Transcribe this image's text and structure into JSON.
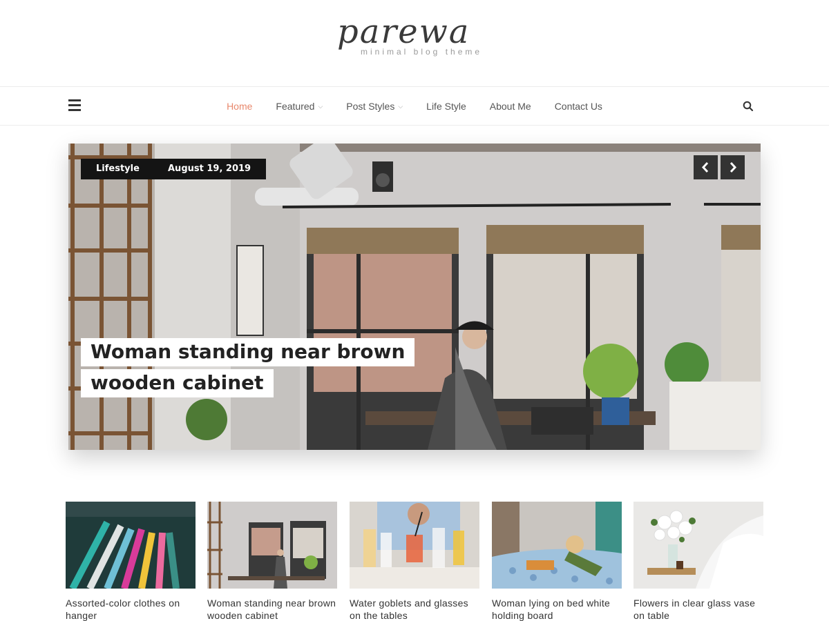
{
  "header": {
    "logo_text": "parewa",
    "tagline": "minimal blog theme"
  },
  "nav": {
    "menu_icon": "hamburger-icon",
    "items": [
      {
        "label": "Home",
        "active": true,
        "has_dropdown": false
      },
      {
        "label": "Featured",
        "active": false,
        "has_dropdown": true
      },
      {
        "label": "Post Styles",
        "active": false,
        "has_dropdown": true
      },
      {
        "label": "Life Style",
        "active": false,
        "has_dropdown": false
      },
      {
        "label": "About Me",
        "active": false,
        "has_dropdown": false
      },
      {
        "label": "Contact Us",
        "active": false,
        "has_dropdown": false
      }
    ],
    "search_icon": "search-icon",
    "active_color": "#e8886c"
  },
  "hero": {
    "category": "Lifestyle",
    "date": "August 19, 2019",
    "title": "Woman standing near brown wooden cabinet",
    "prev_icon": "chevron-left-icon",
    "next_icon": "chevron-right-icon"
  },
  "posts": [
    {
      "title": "Assorted-color clothes on hanger"
    },
    {
      "title": "Woman standing near brown wooden cabinet"
    },
    {
      "title": "Water goblets and glasses on the tables"
    },
    {
      "title": "Woman lying on bed white holding board"
    },
    {
      "title": "Flowers in clear glass vase on table"
    }
  ]
}
